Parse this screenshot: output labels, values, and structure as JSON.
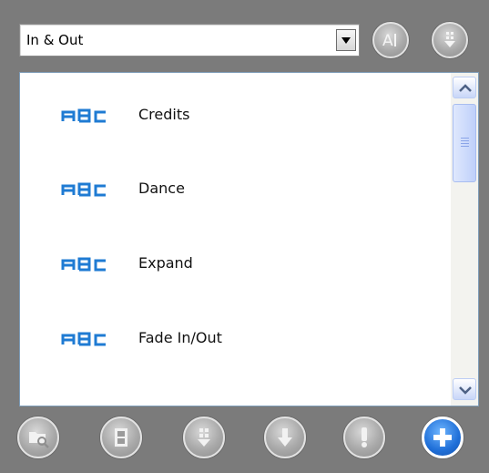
{
  "dropdown": {
    "value": "In & Out"
  },
  "top_buttons": [
    {
      "name": "text-style-button",
      "icon": "text-ai-icon"
    },
    {
      "name": "more-options-button",
      "icon": "list-down-icon"
    }
  ],
  "list": {
    "items": [
      {
        "label": "Credits",
        "icon": "abc-icon"
      },
      {
        "label": "Dance",
        "icon": "abc-icon"
      },
      {
        "label": "Expand",
        "icon": "abc-icon"
      },
      {
        "label": "Fade In/Out",
        "icon": "abc-icon"
      }
    ]
  },
  "bottom_buttons": [
    {
      "name": "search-button",
      "icon": "folder-search-icon"
    },
    {
      "name": "film-button",
      "icon": "film-icon"
    },
    {
      "name": "move-down-button",
      "icon": "list-down-icon"
    },
    {
      "name": "download-button",
      "icon": "arrow-down-icon"
    },
    {
      "name": "alert-button",
      "icon": "exclamation-icon"
    },
    {
      "name": "add-button",
      "icon": "plus-icon"
    }
  ],
  "colors": {
    "abc_icon": "#1f7bd3",
    "add_button": "#1f6fd8"
  }
}
